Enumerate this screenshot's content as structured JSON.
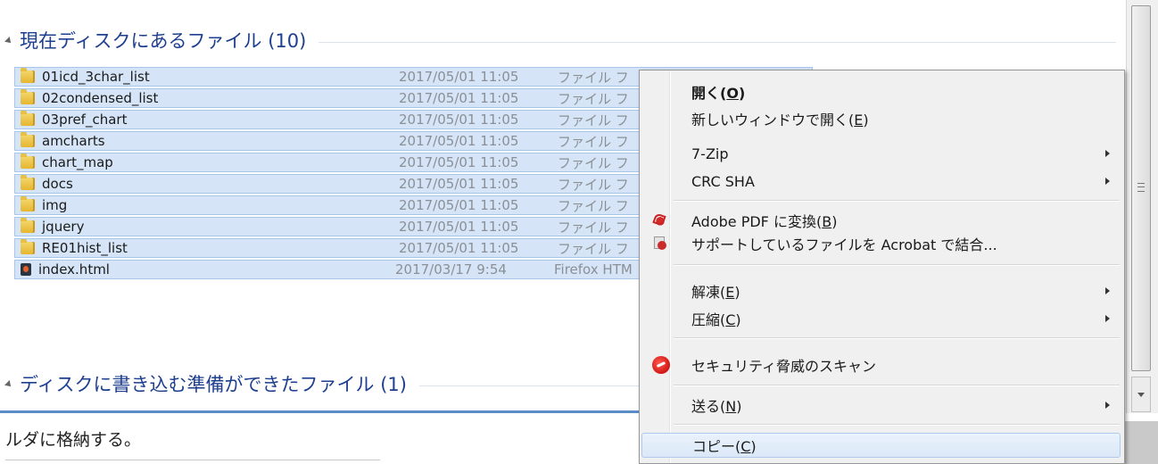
{
  "explorer": {
    "group_current": "現在ディスクにあるファイル (10)",
    "group_ready": "ディスクに書き込む準備ができたファイル (1)",
    "files": [
      {
        "name": "01icd_3char_list",
        "date": "2017/05/01 11:05",
        "type": "ファイル フ",
        "icon": "folder-icon"
      },
      {
        "name": "02condensed_list",
        "date": "2017/05/01 11:05",
        "type": "ファイル フ",
        "icon": "folder-icon"
      },
      {
        "name": "03pref_chart",
        "date": "2017/05/01 11:05",
        "type": "ファイル フ",
        "icon": "folder-icon"
      },
      {
        "name": "amcharts",
        "date": "2017/05/01 11:05",
        "type": "ファイル フ",
        "icon": "folder-icon"
      },
      {
        "name": "chart_map",
        "date": "2017/05/01 11:05",
        "type": "ファイル フ",
        "icon": "folder-icon"
      },
      {
        "name": "docs",
        "date": "2017/05/01 11:05",
        "type": "ファイル フ",
        "icon": "folder-icon"
      },
      {
        "name": "img",
        "date": "2017/05/01 11:05",
        "type": "ファイル フ",
        "icon": "folder-icon"
      },
      {
        "name": "jquery",
        "date": "2017/05/01 11:05",
        "type": "ファイル フ",
        "icon": "folder-icon"
      },
      {
        "name": "RE01hist_list",
        "date": "2017/05/01 11:05",
        "type": "ファイル フ",
        "icon": "folder-icon"
      },
      {
        "name": "index.html",
        "date": "2017/03/17 9:54",
        "type": "Firefox HTM",
        "icon": "firefox-html-icon"
      }
    ]
  },
  "lower": {
    "text": "ルダに格納する。"
  },
  "context_menu": {
    "open": {
      "text": "開く(",
      "key": "O",
      "end": ")"
    },
    "open_new_window": {
      "text": "新しいウィンドウで開く(",
      "key": "E",
      "end": ")"
    },
    "zip": "7-Zip",
    "crc": "CRC SHA",
    "pdf": {
      "text": "Adobe PDF に変換(",
      "key": "B",
      "end": ")"
    },
    "acrobat": "サポートしているファイルを Acrobat で結合...",
    "extract": {
      "text": "解凍(",
      "key": "E",
      "end": ")"
    },
    "compress": {
      "text": "圧縮(",
      "key": "C",
      "end": ")"
    },
    "scan": "セキュリティ脅威のスキャン",
    "send": {
      "text": "送る(",
      "key": "N",
      "end": ")"
    },
    "copy": {
      "text": "コピー(",
      "key": "C",
      "end": ")"
    }
  }
}
